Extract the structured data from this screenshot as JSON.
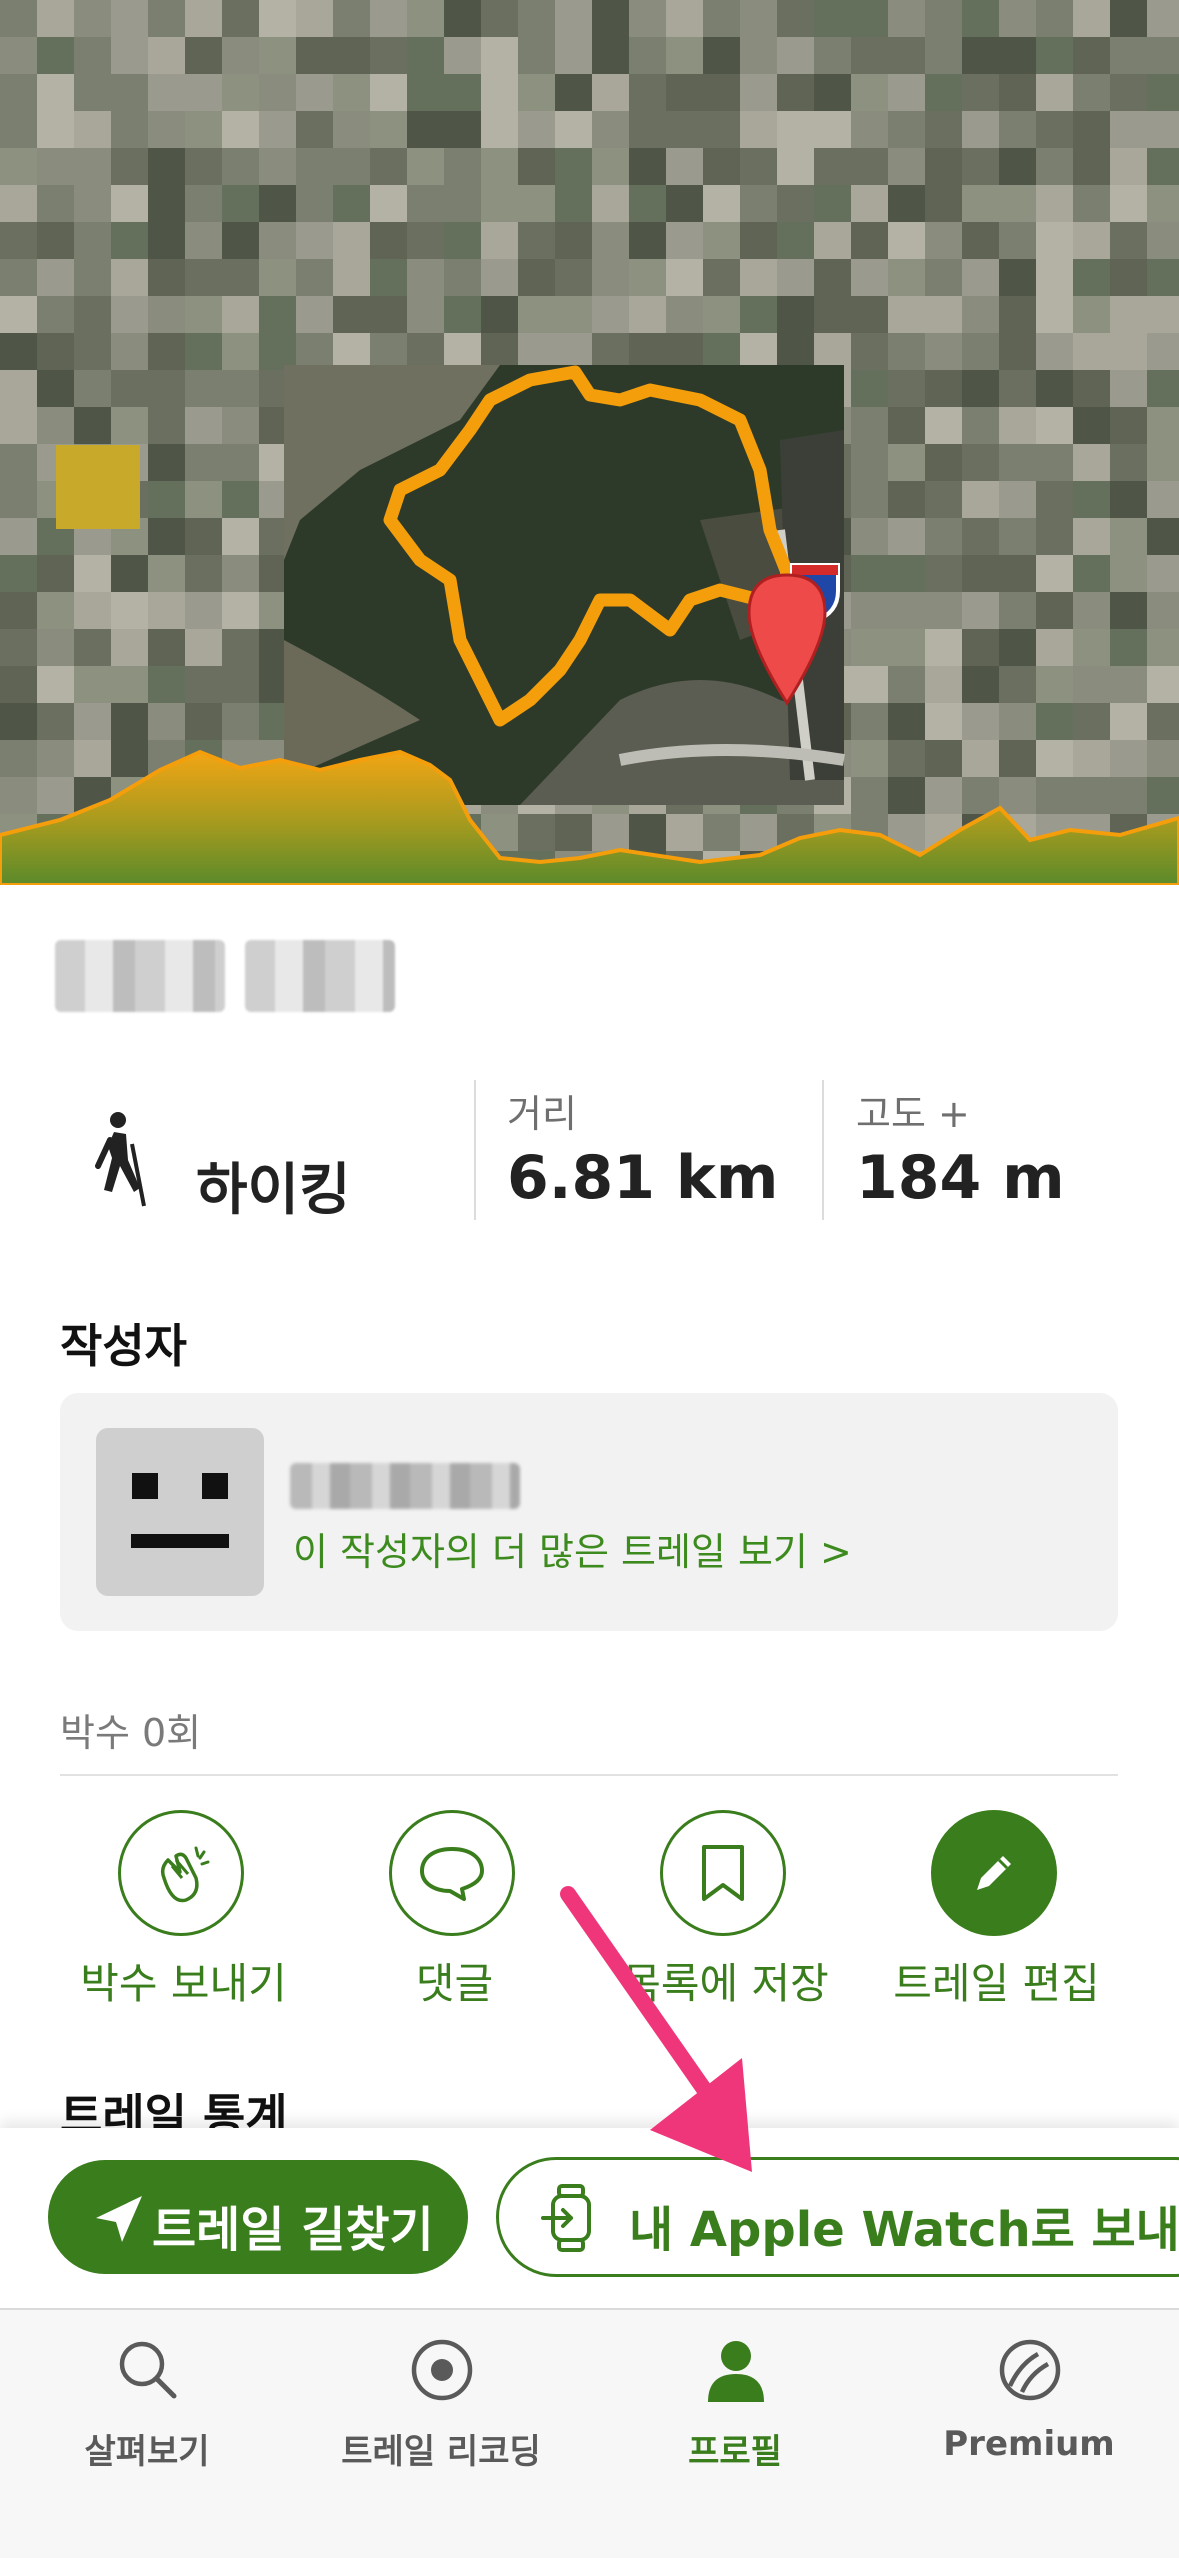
{
  "trail": {
    "activity": "하이킹",
    "distance_label": "거리",
    "distance_value": "6.81 km",
    "elevation_label": "고도 +",
    "elevation_value": "184 m"
  },
  "author": {
    "section_title": "작성자",
    "more_trails_link": "이 작성자의 더 많은 트레일 보기 >"
  },
  "claps": {
    "count_text": "박수 0회"
  },
  "actions": [
    {
      "label": "박수 보내기",
      "icon": "clapping-hands-icon"
    },
    {
      "label": "댓글",
      "icon": "comment-bubble-icon"
    },
    {
      "label": "목록에 저장",
      "icon": "bookmark-icon"
    },
    {
      "label": "트레일 편집",
      "icon": "pencil-icon"
    }
  ],
  "trail_stats_title": "트레일 통계",
  "bottom_actions": {
    "navigate": "트레일 길찾기",
    "send_watch": "내 Apple Watch로 보내기"
  },
  "tabs": [
    {
      "label": "살펴보기",
      "icon": "search-icon"
    },
    {
      "label": "트레일 리코딩",
      "icon": "record-icon"
    },
    {
      "label": "프로필",
      "icon": "profile-icon",
      "active": true
    },
    {
      "label": "Premium",
      "icon": "premium-icon"
    }
  ],
  "colors": {
    "accent": "#3a7d1c",
    "route": "#f59e0b",
    "arrow": "#f0367a",
    "profile_top": "#f2a514",
    "profile_bottom": "#5a8a2a"
  }
}
